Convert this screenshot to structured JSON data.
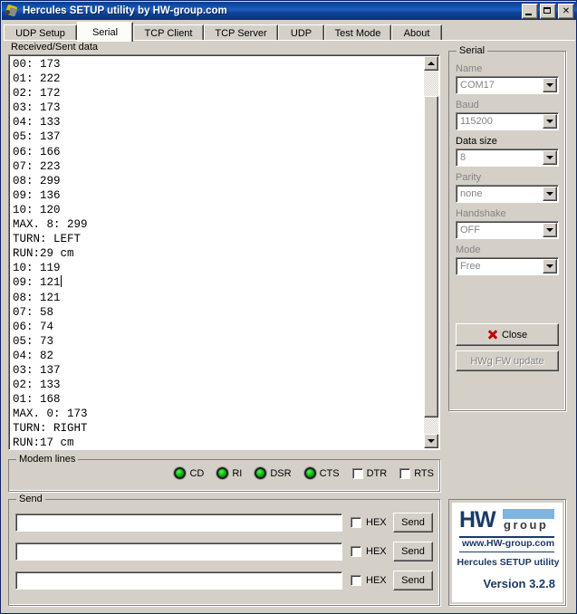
{
  "window": {
    "title": "Hercules SETUP utility by HW-group.com",
    "icon": "app-icon",
    "buttons": {
      "minimize": "_",
      "maximize": "□",
      "close": "✕"
    }
  },
  "tabs": [
    {
      "label": "UDP Setup",
      "active": false
    },
    {
      "label": "Serial",
      "active": true
    },
    {
      "label": "TCP Client",
      "active": false
    },
    {
      "label": "TCP Server",
      "active": false
    },
    {
      "label": "UDP",
      "active": false
    },
    {
      "label": "Test Mode",
      "active": false
    },
    {
      "label": "About",
      "active": false
    }
  ],
  "received": {
    "label": "Received/Sent data",
    "lines": [
      "00: 173",
      "01: 222",
      "02: 172",
      "03: 173",
      "04: 133",
      "05: 137",
      "06: 166",
      "07: 223",
      "08: 299",
      "09: 136",
      "10: 120",
      "MAX. 8: 299",
      "TURN: LEFT",
      "RUN:29 cm",
      "10: 119",
      "09: 121",
      "08: 121",
      "07: 58",
      "06: 74",
      "05: 73",
      "04: 82",
      "03: 137",
      "02: 133",
      "01: 168",
      "MAX. 0: 173",
      "TURN: RIGHT",
      "RUN:17 cm"
    ],
    "caret_line_index": 15,
    "scrollbar": {
      "up_arrow": "▲",
      "down_arrow": "▼"
    }
  },
  "serial": {
    "title": "Serial",
    "fields": [
      {
        "label": "Name",
        "value": "COM17",
        "label_enabled": false
      },
      {
        "label": "Baud",
        "value": "115200",
        "label_enabled": false
      },
      {
        "label": "Data size",
        "value": "8",
        "label_enabled": true
      },
      {
        "label": "Parity",
        "value": "none",
        "label_enabled": false
      },
      {
        "label": "Handshake",
        "value": "OFF",
        "label_enabled": false
      },
      {
        "label": "Mode",
        "value": "Free",
        "label_enabled": false
      }
    ],
    "close_button": "Close",
    "close_icon": "red-x-icon",
    "fw_update_button": "HWg FW update",
    "fw_update_enabled": false
  },
  "modem_lines": {
    "title": "Modem lines",
    "leds": [
      {
        "label": "CD",
        "state": "on",
        "color": "#15c215"
      },
      {
        "label": "RI",
        "state": "on",
        "color": "#15c215"
      },
      {
        "label": "DSR",
        "state": "on",
        "color": "#15c215"
      },
      {
        "label": "CTS",
        "state": "on",
        "color": "#15c215"
      }
    ],
    "checkboxes": [
      {
        "label": "DTR",
        "checked": false
      },
      {
        "label": "RTS",
        "checked": false
      }
    ]
  },
  "send": {
    "title": "Send",
    "rows": [
      {
        "value": "",
        "placeholder": "",
        "hex_label": "HEX",
        "hex_checked": false,
        "button": "Send"
      },
      {
        "value": "",
        "placeholder": "",
        "hex_label": "HEX",
        "hex_checked": false,
        "button": "Send"
      },
      {
        "value": "",
        "placeholder": "",
        "hex_label": "HEX",
        "hex_checked": false,
        "button": "Send"
      }
    ]
  },
  "logo": {
    "mark_hw": "HW",
    "mark_group": "group",
    "url": "www.HW-group.com",
    "app_name": "Hercules SETUP utility",
    "version": "Version  3.2.8",
    "brand_color": "#1b3a66",
    "accent_color": "#7fb4de"
  }
}
